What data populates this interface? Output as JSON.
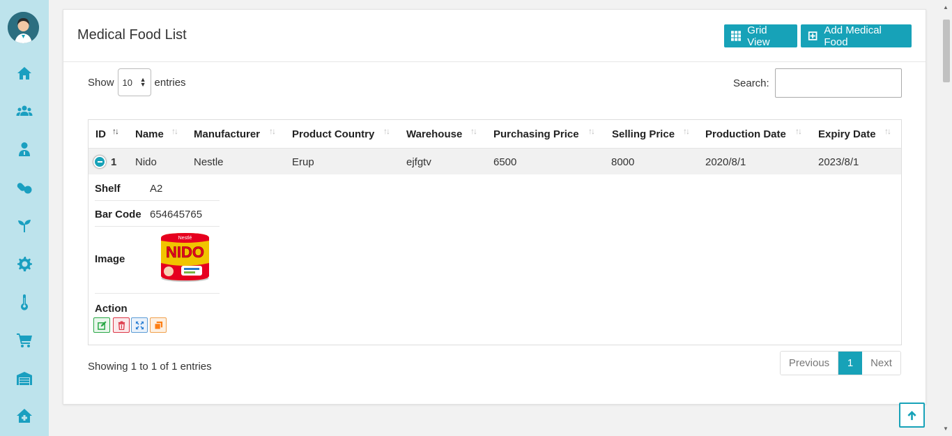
{
  "sidebar": {
    "avatar_alt": "user avatar",
    "items": [
      {
        "icon": "home-icon"
      },
      {
        "icon": "users-icon"
      },
      {
        "icon": "doctor-icon"
      },
      {
        "icon": "pills-icon"
      },
      {
        "icon": "seedling-icon"
      },
      {
        "icon": "gear-icon"
      },
      {
        "icon": "thermometer-icon"
      },
      {
        "icon": "cart-icon"
      },
      {
        "icon": "warehouse-icon"
      },
      {
        "icon": "clinic-icon"
      }
    ]
  },
  "header": {
    "title": "Medical Food List",
    "grid_view_label": "Grid View",
    "add_label": "Add Medical Food"
  },
  "controls": {
    "show_label": "Show",
    "entries_value": "10",
    "entries_label": "entries",
    "search_label": "Search:",
    "search_value": ""
  },
  "table": {
    "columns": [
      "ID",
      "Name",
      "Manufacturer",
      "Product Country",
      "Warehouse",
      "Purchasing Price",
      "Selling Price",
      "Production Date",
      "Expiry Date"
    ],
    "rows": [
      {
        "id": "1",
        "name": "Nido",
        "manufacturer": "Nestle",
        "country": "Erup",
        "warehouse": "ejfgtv",
        "purchasing_price": "6500",
        "selling_price": "8000",
        "production_date": "2020/8/1",
        "expiry_date": "2023/8/1"
      }
    ],
    "detail": {
      "shelf_label": "Shelf",
      "shelf_value": "A2",
      "barcode_label": "Bar Code",
      "barcode_value": "654645765",
      "image_label": "Image",
      "image_brand": "NIDO",
      "image_maker": "Nestlé",
      "action_label": "Action"
    }
  },
  "footer": {
    "info": "Showing 1 to 1 of 1 entries",
    "prev": "Previous",
    "current_page": "1",
    "next": "Next"
  },
  "colors": {
    "accent": "#17a2b8",
    "sidebar_bg": "#bde3ec",
    "edit": "#28a745",
    "delete": "#dc3545",
    "expand": "#007bff",
    "copy": "#fd7e14"
  }
}
